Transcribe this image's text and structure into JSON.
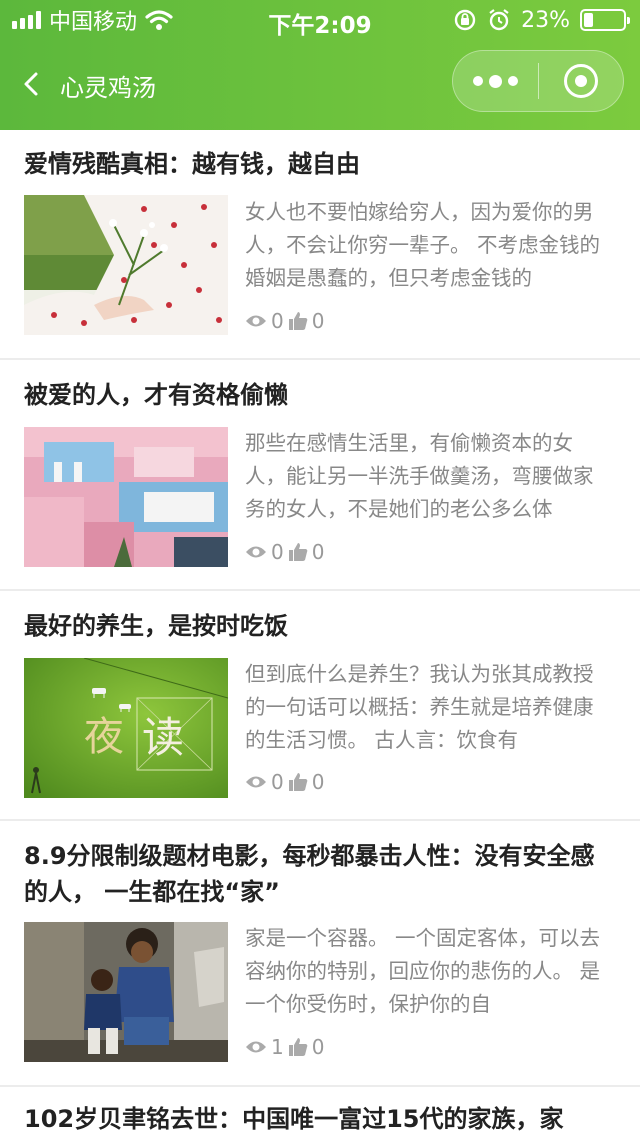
{
  "status_bar": {
    "carrier": "中国移动",
    "time": "下午2:09",
    "battery_percent": "23%",
    "battery_level": 0.23
  },
  "nav": {
    "title": "心灵鸡汤"
  },
  "articles": [
    {
      "title": "爱情残酷真相：越有钱，越自由",
      "excerpt": "女人也不要怕嫁给穷人，因为爱你的男人，不会让你穷一辈子。 不考虑金钱的婚姻是愚蠢的，但只考虑金钱的",
      "views": "0",
      "likes": "0",
      "thumb": "woman-holding-flowers"
    },
    {
      "title": "被爱的人，才有资格偷懒",
      "excerpt": "那些在感情生活里，有偷懒资本的女人，能让另一半洗手做羹汤，弯腰做家务的女人，不是她们的老公多么体",
      "views": "0",
      "likes": "0",
      "thumb": "pink-architecture"
    },
    {
      "title": "最好的养生，是按时吃饭",
      "excerpt": "但到底什么是养生？我认为张其成教授的一句话可以概括：养生就是培养健康的生活习惯。 古人言：饮食有",
      "views": "0",
      "likes": "0",
      "thumb": "night-reading-green",
      "thumb_text": [
        "夜",
        "读"
      ]
    },
    {
      "title": "8.9分限制级题材电影，每秒都暴击人性：没有安全感的人， 一生都在找“家”",
      "excerpt": "家是一个容器。 一个固定客体，可以去容纳你的特别，回应你的悲伤的人。 是一个你受伤时，保护你的自",
      "views": "1",
      "likes": "0",
      "thumb": "two-children-photo"
    },
    {
      "title": "102岁贝聿铭去世：中国唯一富过15代的家族，家"
    }
  ],
  "icons": {
    "view": "eye-icon",
    "like": "thumbs-up-icon",
    "back": "chevron-left-icon",
    "more": "more-dots-icon",
    "close": "target-circle-icon"
  },
  "colors": {
    "header_start": "#5cb83c",
    "header_end": "#7ccb3e",
    "title_text": "#222222",
    "excerpt_text": "#888888"
  }
}
